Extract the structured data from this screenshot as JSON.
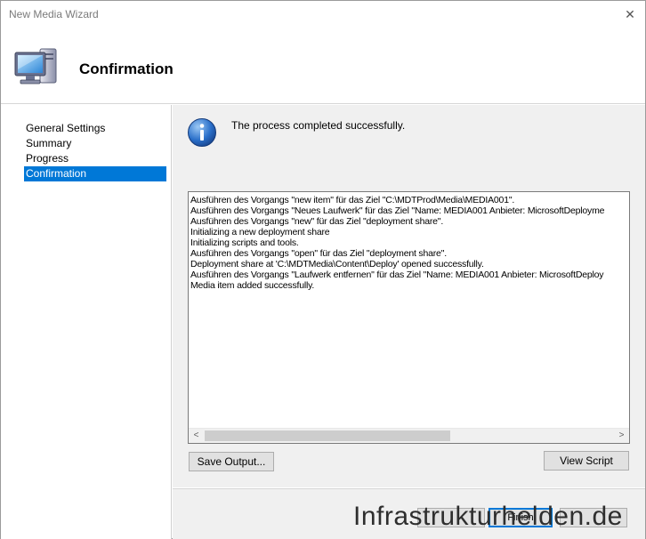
{
  "window": {
    "title": "New Media Wizard",
    "close_glyph": "✕"
  },
  "header": {
    "title": "Confirmation",
    "icon": "computer-icon"
  },
  "sidebar": {
    "steps": [
      {
        "label": "General Settings",
        "active": false
      },
      {
        "label": "Summary",
        "active": false
      },
      {
        "label": "Progress",
        "active": false
      },
      {
        "label": "Confirmation",
        "active": true
      }
    ]
  },
  "main": {
    "status_icon": "info-icon",
    "status_text": "The process completed successfully.",
    "log_lines": [
      "Ausführen des Vorgangs \"new item\" für das Ziel \"C:\\MDTProd\\Media\\MEDIA001\".",
      "Ausführen des Vorgangs \"Neues Laufwerk\" für das Ziel \"Name: MEDIA001 Anbieter: MicrosoftDeployme",
      "Ausführen des Vorgangs \"new\" für das Ziel \"deployment share\".",
      "Initializing a new deployment share",
      "Initializing scripts and tools.",
      "Ausführen des Vorgangs \"open\" für das Ziel \"deployment share\".",
      "Deployment share at 'C:\\MDTMedia\\Content\\Deploy' opened successfully.",
      "Ausführen des Vorgangs \"Laufwerk entfernen\" für das Ziel \"Name: MEDIA001 Anbieter: MicrosoftDeploy",
      "Media item added successfully."
    ],
    "scroll_left": "<",
    "scroll_right": ">",
    "save_output_label": "Save Output...",
    "view_script_label": "View Script"
  },
  "footer": {
    "finish_label": "Finish"
  },
  "watermark": "Infrastrukturhelden.de",
  "colors": {
    "accent": "#0078d7",
    "background": "#f0f0f0"
  }
}
